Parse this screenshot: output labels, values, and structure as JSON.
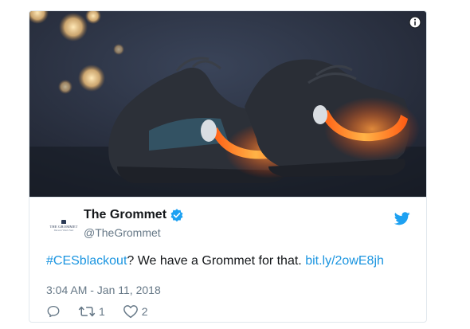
{
  "tweet": {
    "author": {
      "display_name": "The Grommet",
      "handle": "@TheGrommet",
      "avatar_logo_text": "THE GROMMET",
      "avatar_logo_sub": "Discover What's Next",
      "verified_icon": "verified-badge-icon"
    },
    "text": {
      "hashtag": "#CESblackout",
      "body": "? We have a Grommet for that. ",
      "link": "bit.ly/2owE8jh"
    },
    "timestamp": "3:04 AM - Jan 11, 2018",
    "actions": {
      "reply_icon": "reply-icon",
      "retweet_icon": "retweet-icon",
      "retweet_count": "1",
      "like_icon": "heart-icon",
      "like_count": "2"
    },
    "media": {
      "description_icon": "info-icon"
    },
    "brand_icon": "twitter-bird-icon"
  },
  "colors": {
    "link": "#1b95e0",
    "secondary_text": "#657786",
    "border": "#e1e8ed",
    "glow": "#ff7a1a"
  }
}
